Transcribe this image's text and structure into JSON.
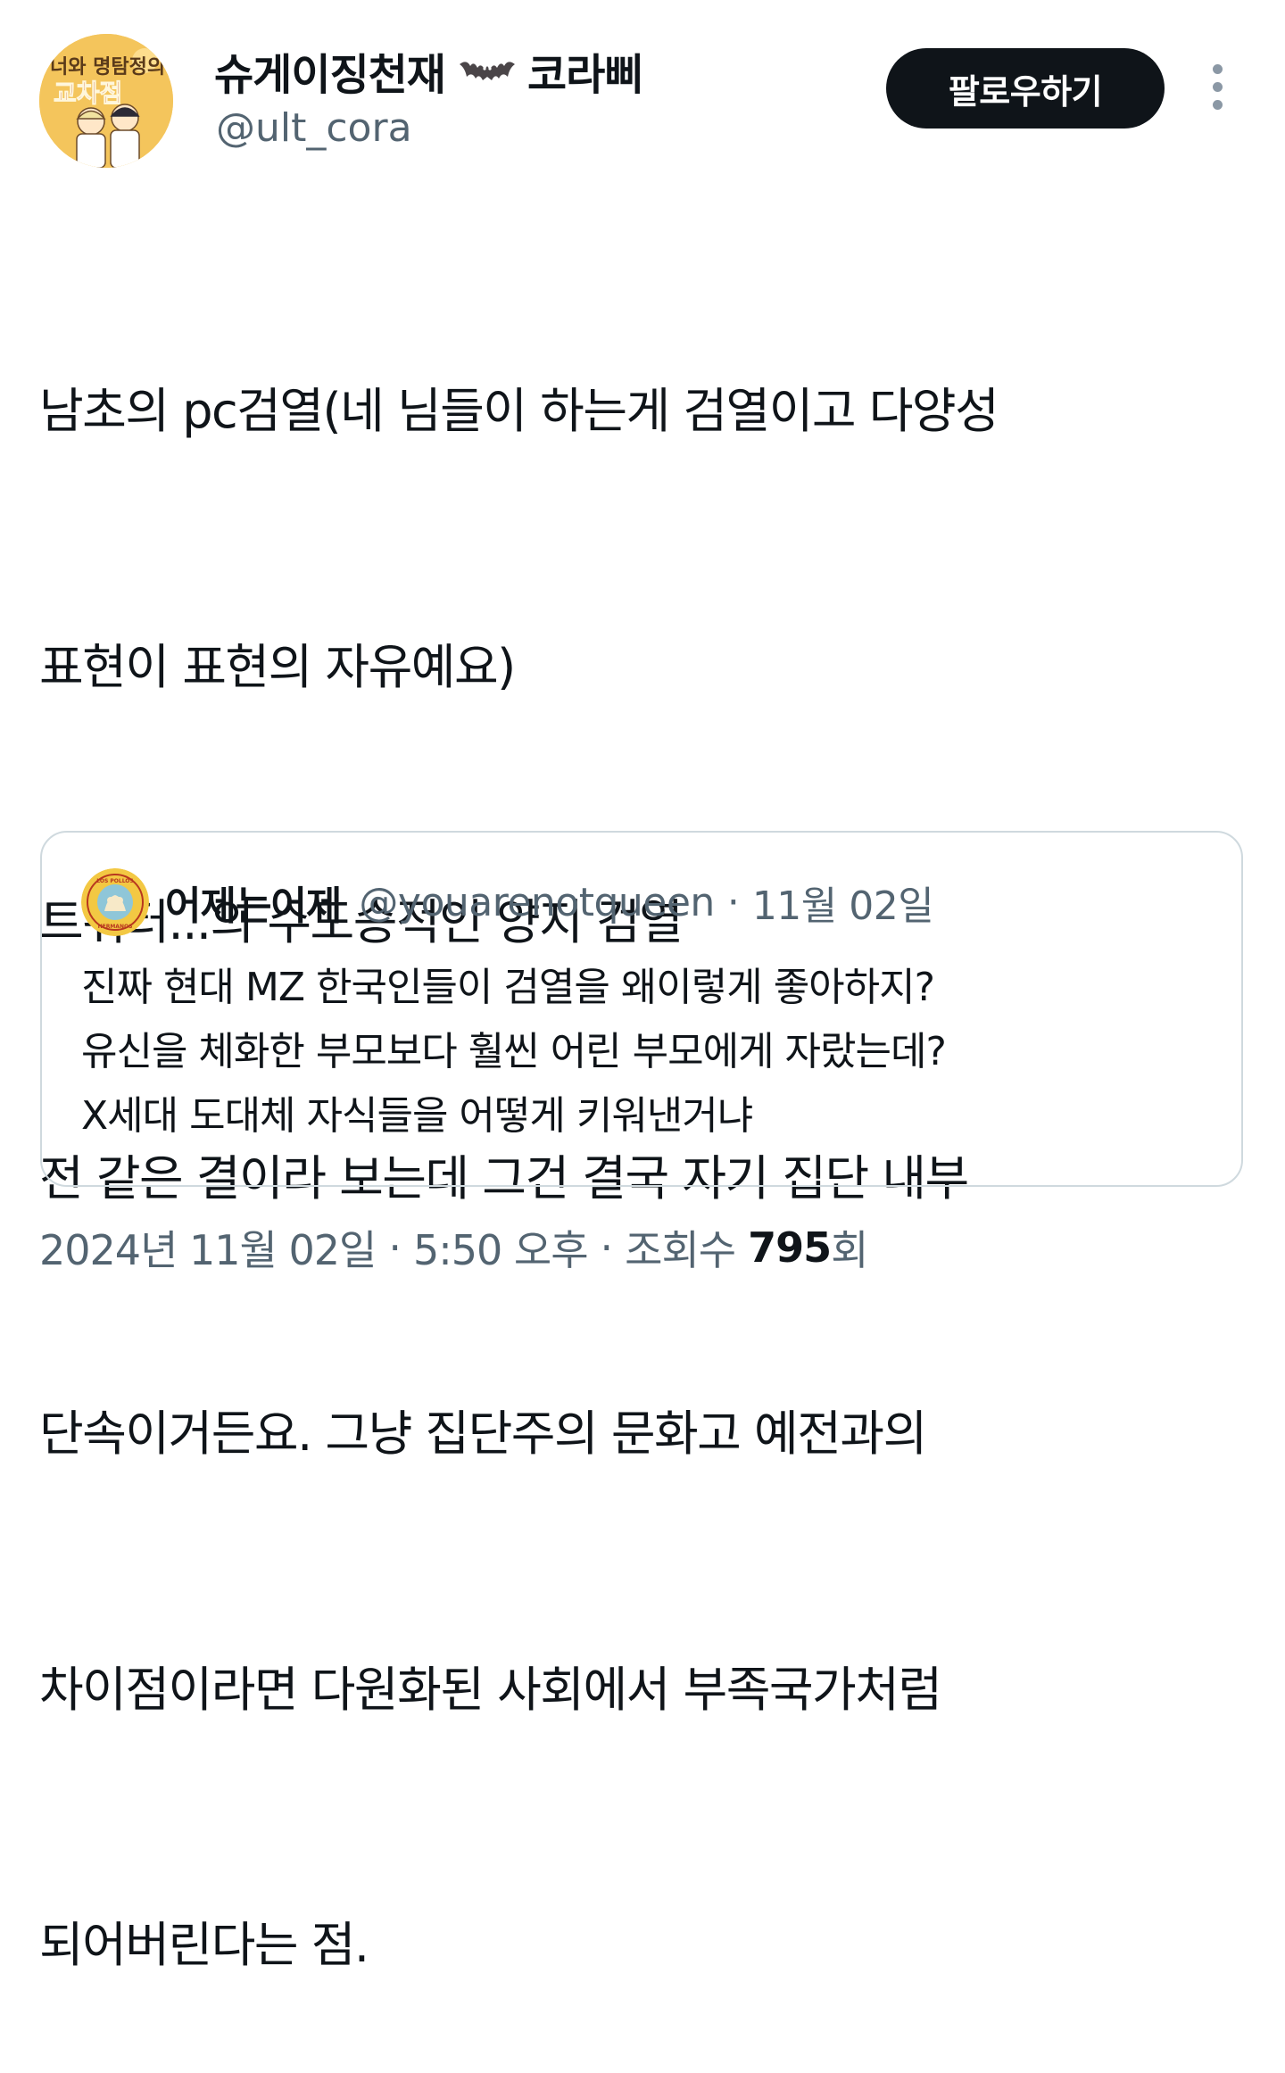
{
  "author": {
    "avatar_icon": "avatar-comic-cover",
    "avatar_text": "너와 명탐정의 교차점",
    "display_name_part1": "슈게이징천재",
    "display_name_icon": "bat-emoji",
    "display_name_part2": "코라삐",
    "handle": "@ult_cora"
  },
  "follow_button": {
    "label": "팔로우하기"
  },
  "more_icon": "more-vertical-icon",
  "tweet": {
    "lines": [
      "남초의 pc검열(네 님들이 하는게 검열이고 다양성",
      "표현이 표현의 자유예요)",
      "트위터...의 수도승적인 양지 검열",
      "전 같은 결이라 보는데 그건 결국 자기 집단 내부",
      "단속이거든요. 그냥 집단주의 문화고 예전과의",
      "차이점이라면 다원화된 사회에서 부족국가처럼",
      "되어버린다는 점."
    ]
  },
  "quote": {
    "avatar_icon": "avatar-los-pollos-hermanos",
    "avatar_text_top": "LOS POLLOS",
    "avatar_text_bottom": "HERMANOS",
    "name": "어제는어제",
    "handle": "@youarenotqueen",
    "separator": "·",
    "date": "11월 02일",
    "lines": [
      "진짜 현대 MZ 한국인들이 검열을 왜이렇게 좋아하지?",
      "유신을 체화한 부모보다 훨씬 어린 부모에게 자랐는데?",
      "X세대 도대체 자식들을 어떻게 키워낸거냐"
    ]
  },
  "meta": {
    "date": "2024년 11월 02일",
    "separator": "·",
    "time": "5:50 오후",
    "views_label": "조회수",
    "views_count": "795",
    "views_suffix": "회"
  },
  "colors": {
    "text_primary": "#0f1419",
    "text_secondary": "#536471",
    "border": "#cfd9de",
    "button_bg": "#0f1419",
    "button_text": "#ffffff"
  }
}
